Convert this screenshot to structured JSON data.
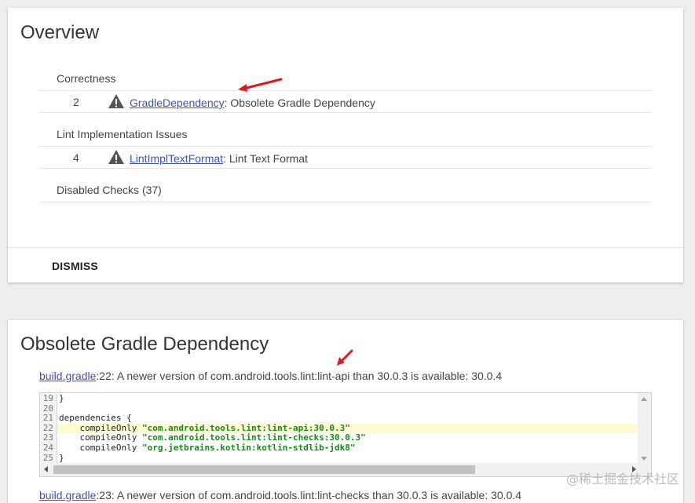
{
  "overview": {
    "title": "Overview",
    "categories": [
      {
        "name": "Correctness",
        "issues": [
          {
            "count": "2",
            "id": "GradleDependency",
            "desc": ": Obsolete Gradle Dependency"
          }
        ]
      },
      {
        "name": "Lint Implementation Issues",
        "issues": [
          {
            "count": "4",
            "id": "LintImplTextFormat",
            "desc": ": Lint Text Format"
          }
        ]
      }
    ],
    "disabled_checks": "Disabled Checks (37)",
    "dismiss_label": "DISMISS"
  },
  "detail": {
    "title": "Obsolete Gradle Dependency",
    "locations": [
      {
        "file": "build.gradle",
        "message": ":22: A newer version of com.android.tools.lint:lint-api than 30.0.3 is available: 30.0.4"
      },
      {
        "file": "build.gradle",
        "message": ":23: A newer version of com.android.tools.lint:lint-checks than 30.0.3 is available: 30.0.4"
      }
    ],
    "code": [
      {
        "ln": "19",
        "text": "}",
        "str": ""
      },
      {
        "ln": "20",
        "text": "",
        "str": ""
      },
      {
        "ln": "21",
        "text": "dependencies {",
        "str": ""
      },
      {
        "ln": "22",
        "text": "    compileOnly ",
        "str": "\"com.android.tools.lint:lint-api:30.0.3\""
      },
      {
        "ln": "23",
        "text": "    compileOnly ",
        "str": "\"com.android.tools.lint:lint-checks:30.0.3\""
      },
      {
        "ln": "24",
        "text": "    compileOnly ",
        "str": "\"org.jetbrains.kotlin:kotlin-stdlib-jdk8\""
      },
      {
        "ln": "25",
        "text": "}",
        "str": ""
      }
    ],
    "highlight_color": "#fcfcd0"
  },
  "icons": {
    "warning": "warning-triangle-icon",
    "annotation": "red-arrow-icon"
  },
  "colors": {
    "link": "#3f51b5",
    "arrow": "#e0191f",
    "code_string": "#168a16"
  },
  "watermark": "@稀土掘金技术社区"
}
